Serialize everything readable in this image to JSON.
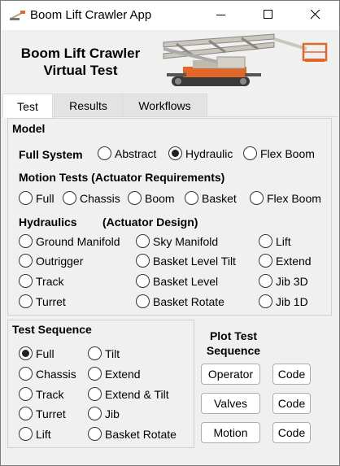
{
  "window": {
    "title": "Boom Lift Crawler App",
    "minimize_icon": "minimize-icon",
    "maximize_icon": "maximize-icon",
    "close_icon": "close-icon"
  },
  "header": {
    "title_line1": "Boom Lift Crawler",
    "title_line2": "Virtual Test"
  },
  "tabs": [
    {
      "label": "Test",
      "active": true
    },
    {
      "label": "Results",
      "active": false
    },
    {
      "label": "Workflows",
      "active": false
    }
  ],
  "model": {
    "title": "Model",
    "full_system": {
      "label": "Full System",
      "options": [
        "Abstract",
        "Hydraulic",
        "Flex Boom"
      ],
      "selected": "Hydraulic"
    },
    "motion_tests": {
      "label": "Motion Tests  (Actuator Requirements)",
      "options": [
        "Full",
        "Chassis",
        "Boom",
        "Basket",
        "Flex Boom"
      ]
    },
    "hydraulics": {
      "label": "Hydraulics",
      "sublabel": "(Actuator Design)",
      "col1": [
        "Ground Manifold",
        "Outrigger",
        "Track",
        "Turret"
      ],
      "col2": [
        "Sky Manifold",
        "Basket Level Tilt",
        "Basket Level",
        "Basket Rotate"
      ],
      "col3": [
        "Lift",
        "Extend",
        "Jib 3D",
        "Jib 1D"
      ]
    }
  },
  "test_sequence": {
    "title": "Test Sequence",
    "col1": [
      "Full",
      "Chassis",
      "Track",
      "Turret",
      "Lift"
    ],
    "col2": [
      "Tilt",
      "Extend",
      "Extend & Tilt",
      "Jib",
      "Basket Rotate"
    ],
    "selected": "Full"
  },
  "plot": {
    "title_line1": "Plot Test",
    "title_line2": "Sequence",
    "rows": [
      {
        "label": "Operator",
        "code": "Code"
      },
      {
        "label": "Valves",
        "code": "Code"
      },
      {
        "label": "Motion",
        "code": "Code"
      }
    ]
  },
  "colors": {
    "machine_orange": "#e0662a",
    "machine_gray": "#c9c6bd",
    "titlebar": "#ffffff",
    "background": "#f0f0f0"
  }
}
